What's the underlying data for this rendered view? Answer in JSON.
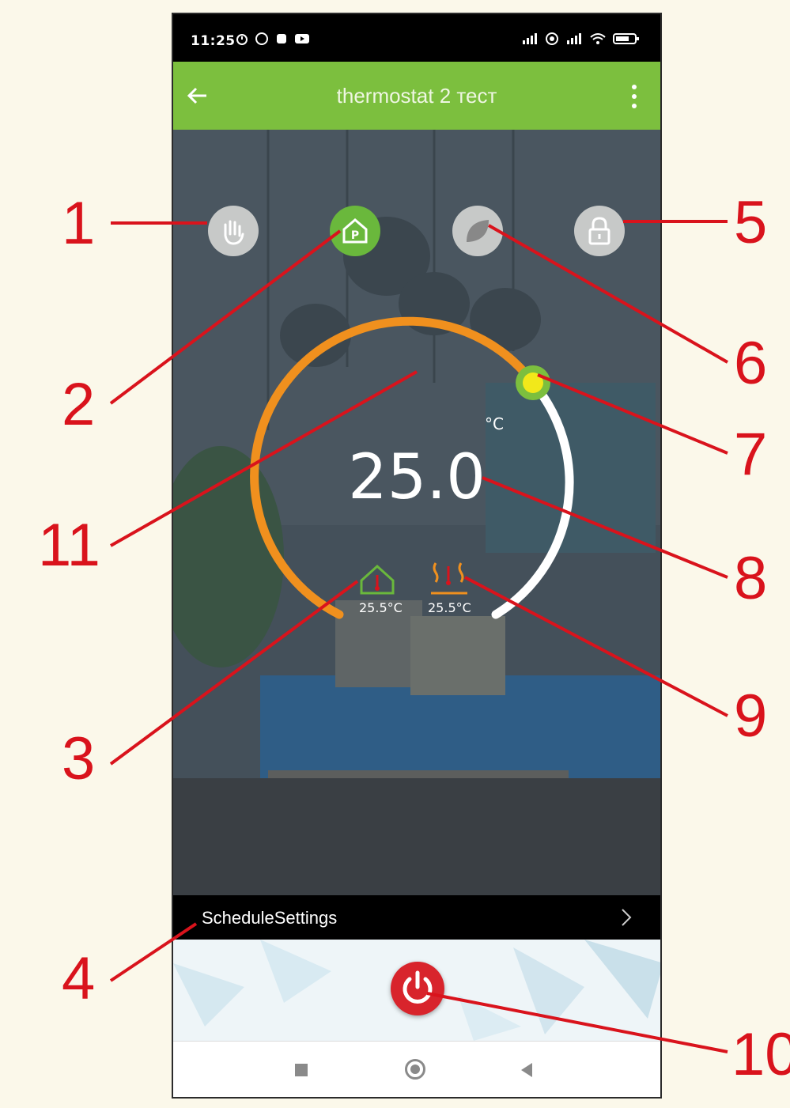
{
  "status_bar": {
    "time": "11:25"
  },
  "app_bar": {
    "title": "thermostat 2 тест",
    "back_icon": "arrow-left-icon",
    "menu_icon": "more-vertical-icon"
  },
  "mode_buttons": [
    {
      "name": "manual-mode",
      "icon": "hand-icon",
      "active": false
    },
    {
      "name": "program-mode",
      "icon": "house-p-icon",
      "active": true
    },
    {
      "name": "eco-mode",
      "icon": "leaf-icon",
      "active": false
    },
    {
      "name": "lock",
      "icon": "padlock-icon",
      "active": false
    }
  ],
  "thermostat": {
    "setpoint": "25.0",
    "unit": "°C",
    "room_temp": "25.5°C",
    "floor_temp": "25.5°C"
  },
  "schedule": {
    "label": "ScheduleSettings"
  },
  "power": {
    "icon": "power-icon"
  },
  "callouts": [
    "1",
    "2",
    "3",
    "4",
    "5",
    "6",
    "7",
    "8",
    "9",
    "10",
    "11"
  ],
  "colors": {
    "accent_green": "#7cbf3e",
    "arc_orange": "#f0901e",
    "power_red": "#d8242c",
    "callout_red": "#d9131c",
    "knob_yellow": "#f2e81a"
  }
}
